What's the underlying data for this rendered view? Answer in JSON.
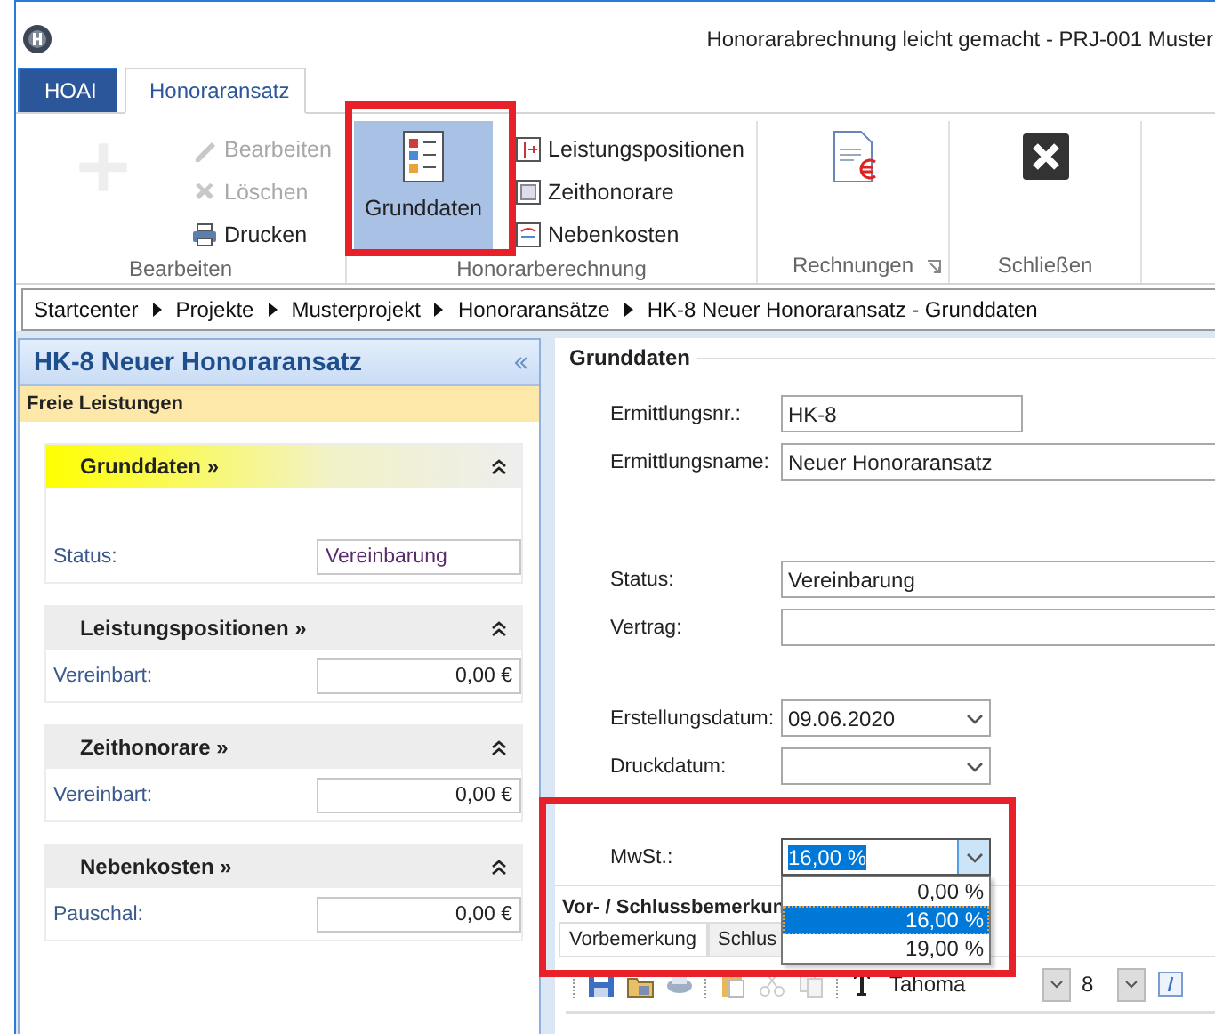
{
  "window": {
    "title": "Honorarabrechnung leicht gemacht - PRJ-001 Muster"
  },
  "ribbon_tabs": [
    {
      "label": "HOAI",
      "kind": "app",
      "selected": false
    },
    {
      "label": "Honoraransatz",
      "kind": "tab",
      "selected": true
    }
  ],
  "ribbon_groups": [
    {
      "label": "Bearbeiten",
      "items": [
        {
          "kind": "large",
          "disabled": true,
          "selected": false
        },
        {
          "kind": "small",
          "label": "Bearbeiten",
          "disabled": true
        },
        {
          "kind": "small",
          "label": "Löschen",
          "disabled": true
        },
        {
          "kind": "small",
          "label": "Drucken",
          "disabled": false
        }
      ]
    },
    {
      "label": "Honorarberechnung",
      "items": [
        {
          "kind": "large",
          "label": "Grunddaten",
          "disabled": false,
          "selected": true
        },
        {
          "kind": "small",
          "label": "Leistungspositionen",
          "disabled": false
        },
        {
          "kind": "small",
          "label": "Zeithonorare",
          "disabled": false
        },
        {
          "kind": "small",
          "label": "Nebenkosten",
          "disabled": false
        }
      ]
    },
    {
      "label": "Rechnungen",
      "launcher": true,
      "items": [
        {
          "kind": "large",
          "disabled": false,
          "selected": false
        }
      ]
    },
    {
      "label": "Schließen",
      "items": [
        {
          "kind": "large",
          "disabled": false,
          "selected": false
        }
      ]
    }
  ],
  "breadcrumb": [
    "Startcenter",
    "Projekte",
    "Musterprojekt",
    "Honoraransätze",
    "HK-8 Neuer Honoraransatz - Grunddaten"
  ],
  "side_panel": {
    "title": "HK-8 Neuer Honoraransatz",
    "subtitle": "Freie Leistungen",
    "sections": [
      {
        "title": "Grunddaten »",
        "selected": true,
        "field_label": "Status:",
        "field_value": "Vereinbarung",
        "kind": "text"
      },
      {
        "title": "Leistungspositionen »",
        "selected": false,
        "field_label": "Vereinbart:",
        "field_value": "0,00 €",
        "kind": "amount"
      },
      {
        "title": "Zeithonorare »",
        "selected": false,
        "field_label": "Vereinbart:",
        "field_value": "0,00 €",
        "kind": "amount"
      },
      {
        "title": "Nebenkosten »",
        "selected": false,
        "field_label": "Pauschal:",
        "field_value": "0,00 €",
        "kind": "amount"
      }
    ]
  },
  "form": {
    "title": "Grunddaten",
    "field_groups": [
      [
        {
          "label": "Ermittlungsnr.:",
          "value": "HK-8",
          "kind": "short"
        },
        {
          "label": "Ermittlungsname:",
          "value": "Neuer Honoraransatz",
          "kind": "wide"
        }
      ],
      [
        {
          "label": "Status:",
          "value": "Vereinbarung",
          "kind": "wide"
        },
        {
          "label": "Vertrag:",
          "kind": "wide"
        }
      ],
      [
        {
          "label": "Erstellungsdatum:",
          "value": "09.06.2020",
          "kind": "dropdown"
        },
        {
          "label": "Druckdatum:",
          "kind": "dropdown"
        }
      ],
      [
        {
          "label": "MwSt.:",
          "value": "16,00 %",
          "kind": "dropdown",
          "focused": true,
          "expanded": true,
          "options": [
            {
              "label": "0,00 %",
              "selected": false
            },
            {
              "label": "16,00 %",
              "selected": true
            },
            {
              "label": "19,00 %",
              "selected": false
            }
          ]
        }
      ]
    ]
  },
  "remarks": {
    "title": "Vor- / Schlussbemerkun",
    "tabs": [
      {
        "label": "Vorbemerkung",
        "selected": true
      },
      {
        "label": "Schlus",
        "selected": false
      }
    ],
    "font": "Tahoma",
    "font_size": "8"
  }
}
